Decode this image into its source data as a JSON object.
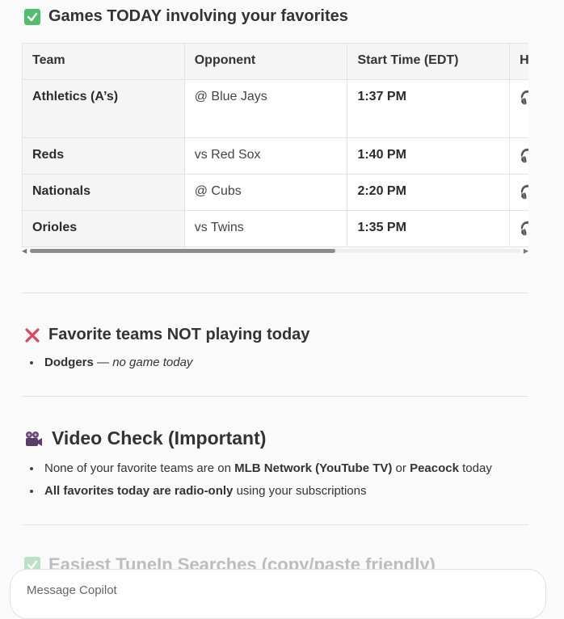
{
  "sections": {
    "games_today": {
      "title": "Games TODAY involving your favorites"
    },
    "not_playing": {
      "title": "Favorite teams NOT playing today"
    },
    "video_check": {
      "title": "Video Check (Important)"
    },
    "tunein": {
      "title": "Easiest TuneIn Searches (copy/paste friendly)"
    }
  },
  "games_table": {
    "headers": [
      "Team",
      "Opponent",
      "Start Time (EDT)",
      "H"
    ],
    "rows": [
      {
        "team": "Athletics (A’s)",
        "opponent": "@ Blue Jays",
        "time": "1:37 PM"
      },
      {
        "team": "Reds",
        "opponent": "vs Red Sox",
        "time": "1:40 PM"
      },
      {
        "team": "Nationals",
        "opponent": "@ Cubs",
        "time": "2:20 PM"
      },
      {
        "team": "Orioles",
        "opponent": "vs Twins",
        "time": "1:35 PM"
      }
    ]
  },
  "not_playing": {
    "items": [
      {
        "team": "Dodgers",
        "sep": " — ",
        "note": "no game today"
      }
    ]
  },
  "video_check": {
    "item1": {
      "a": "None of your favorite teams are on ",
      "b": "MLB Network (YouTube TV)",
      "c": " or ",
      "d": "Peacock",
      "e": " today"
    },
    "item2": {
      "a": "All favorites today are radio-only",
      "b": " using your subscriptions"
    }
  },
  "composer": {
    "placeholder": "Message Copilot"
  },
  "icons": {
    "check": "check-mark-button-icon",
    "cross": "cross-mark-icon",
    "camera": "movie-camera-icon",
    "headphone": "headphone-icon"
  }
}
